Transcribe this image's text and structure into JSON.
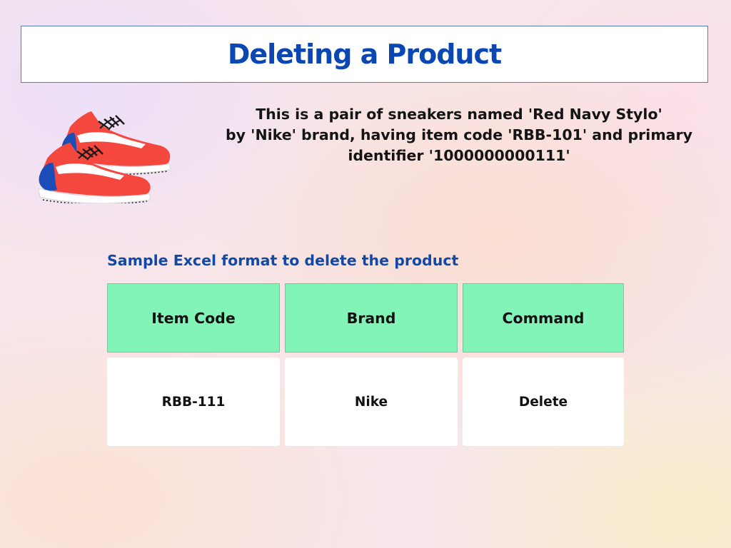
{
  "title": "Deleting a Product",
  "description": {
    "line1": "This is a pair of sneakers named 'Red Navy Stylo'",
    "line2": "by 'Nike' brand, having item code 'RBB-101' and primary",
    "line3": "identifier '1000000000111'"
  },
  "image": {
    "icon": "sneakers-illustration",
    "colors": {
      "upper": "#f4473e",
      "toe": "#1b4cb8",
      "sole": "#ffffff",
      "laces": "#1a1a1a"
    }
  },
  "table": {
    "caption": "Sample Excel format to delete the product",
    "headers": [
      "Item Code",
      "Brand",
      "Command"
    ],
    "rows": [
      [
        "RBB-111",
        "Nike",
        "Delete"
      ]
    ]
  },
  "colors": {
    "title_text": "#0a47b3",
    "caption_text": "#1149a8",
    "header_fill": "#82f4b8",
    "cell_fill": "#ffffff"
  }
}
